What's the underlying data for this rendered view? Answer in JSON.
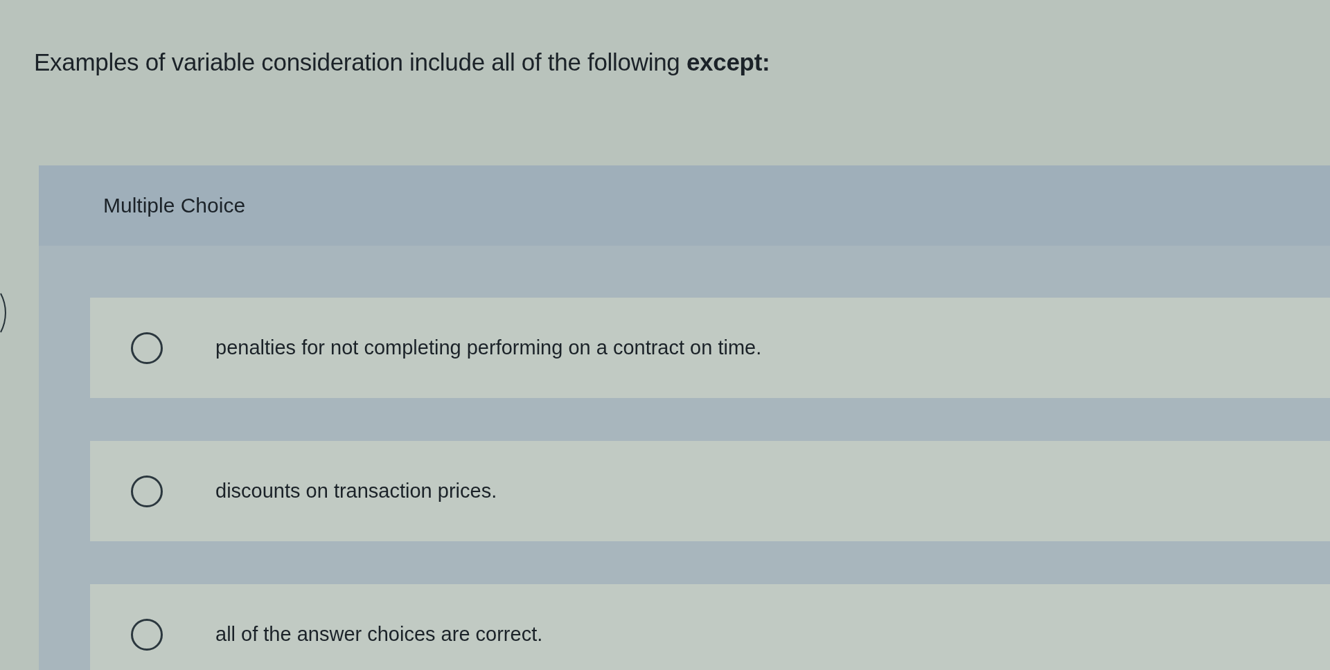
{
  "question": {
    "text": "Examples of variable consideration include all of the following **except:**"
  },
  "question_type": {
    "label": "Multiple Choice"
  },
  "choices": [
    {
      "text": "penalties for not completing performing on a contract on time.",
      "selected": false
    },
    {
      "text": "discounts on transaction prices.",
      "selected": false
    },
    {
      "text": "all of the answer choices are correct.",
      "selected": false
    }
  ]
}
